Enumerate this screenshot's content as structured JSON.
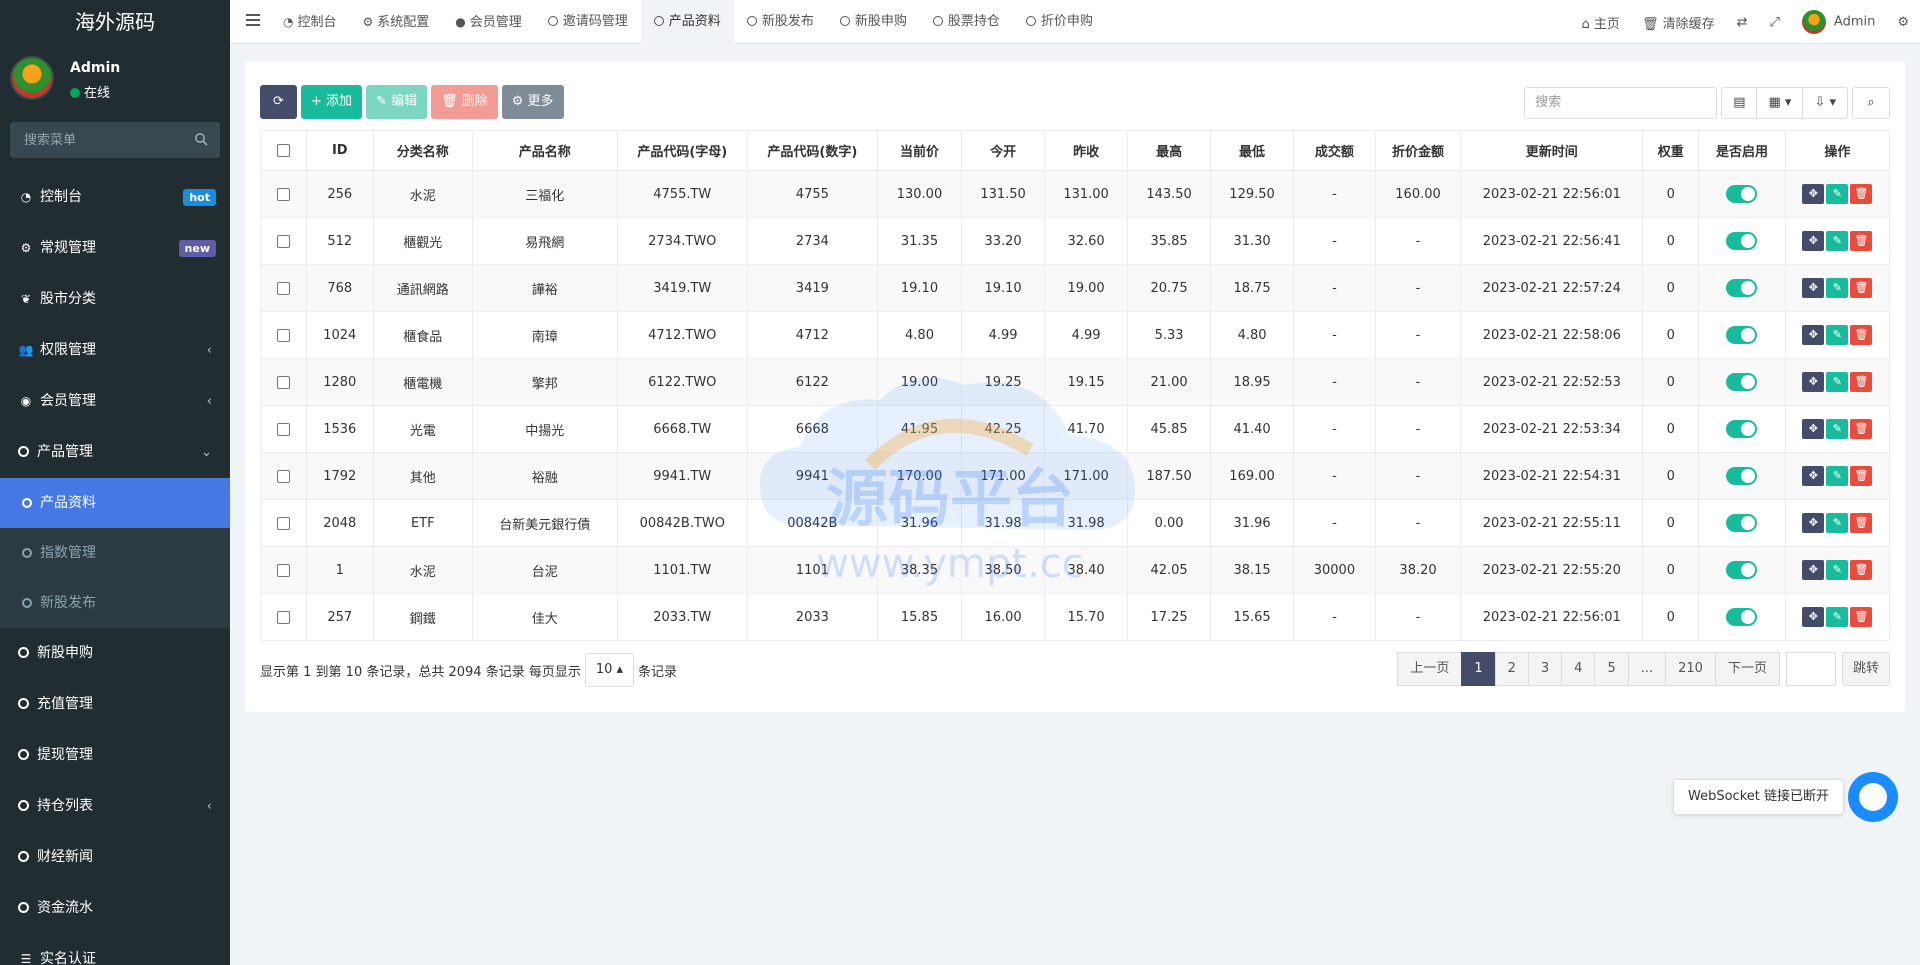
{
  "sidebar": {
    "logo": "海外源码",
    "user": {
      "name": "Admin",
      "status": "在线"
    },
    "search_placeholder": "搜索菜单",
    "items": [
      {
        "label": "控制台",
        "icon": "dashboard-icon",
        "badge": "hot"
      },
      {
        "label": "常规管理",
        "icon": "cogs-icon",
        "badge": "new"
      },
      {
        "label": "股市分类",
        "icon": "leaf-icon"
      },
      {
        "label": "权限管理",
        "icon": "users-icon",
        "chevron": "‹"
      },
      {
        "label": "会员管理",
        "icon": "user-circle-icon",
        "chevron": "‹"
      },
      {
        "label": "产品管理",
        "icon": "circle-icon",
        "chevron": "⌄"
      }
    ],
    "sub_items": [
      {
        "label": "产品资料",
        "active": true
      },
      {
        "label": "指数管理"
      },
      {
        "label": "新股发布"
      }
    ],
    "items_after": [
      {
        "label": "新股申购"
      },
      {
        "label": "充值管理"
      },
      {
        "label": "提现管理"
      },
      {
        "label": "持仓列表",
        "chevron": "‹"
      },
      {
        "label": "财经新闻"
      },
      {
        "label": "资金流水"
      },
      {
        "label": "实名认证"
      }
    ]
  },
  "topnav": {
    "tabs": [
      {
        "label": "控制台",
        "icon": "dashboard-icon"
      },
      {
        "label": "系统配置",
        "icon": "gear-icon"
      },
      {
        "label": "会员管理",
        "icon": "user-icon"
      },
      {
        "label": "邀请码管理",
        "icon": "circle-icon"
      },
      {
        "label": "产品资料",
        "icon": "circle-icon",
        "active": true
      },
      {
        "label": "新股发布",
        "icon": "circle-icon"
      },
      {
        "label": "新股申购",
        "icon": "circle-icon"
      },
      {
        "label": "股票持仓",
        "icon": "circle-icon"
      },
      {
        "label": "折价申购",
        "icon": "circle-icon"
      }
    ],
    "right": {
      "home": "主页",
      "clear_cache": "清除缓存",
      "user": "Admin"
    }
  },
  "toolbar": {
    "refresh_icon": "refresh-icon",
    "add": "添加",
    "edit": "编辑",
    "delete": "删除",
    "more": "更多",
    "search_placeholder": "搜索"
  },
  "table": {
    "columns": [
      "ID",
      "分类名称",
      "产品名称",
      "产品代码(字母)",
      "产品代码(数字)",
      "当前价",
      "今开",
      "昨收",
      "最高",
      "最低",
      "成交额",
      "折价金额",
      "更新时间",
      "权重",
      "是否启用",
      "操作"
    ],
    "rows": [
      [
        "256",
        "水泥",
        "三福化",
        "4755.TW",
        "4755",
        "130.00",
        "131.50",
        "131.00",
        "143.50",
        "129.50",
        "-",
        "160.00",
        "2023-02-21 22:56:01",
        "0"
      ],
      [
        "512",
        "櫃觀光",
        "易飛網",
        "2734.TWO",
        "2734",
        "31.35",
        "33.20",
        "32.60",
        "35.85",
        "31.30",
        "-",
        "-",
        "2023-02-21 22:56:41",
        "0"
      ],
      [
        "768",
        "通訊網路",
        "譁裕",
        "3419.TW",
        "3419",
        "19.10",
        "19.10",
        "19.00",
        "20.75",
        "18.75",
        "-",
        "-",
        "2023-02-21 22:57:24",
        "0"
      ],
      [
        "1024",
        "櫃食品",
        "南璋",
        "4712.TWO",
        "4712",
        "4.80",
        "4.99",
        "4.99",
        "5.33",
        "4.80",
        "-",
        "-",
        "2023-02-21 22:58:06",
        "0"
      ],
      [
        "1280",
        "櫃電機",
        "擎邦",
        "6122.TWO",
        "6122",
        "19.00",
        "19.25",
        "19.15",
        "21.00",
        "18.95",
        "-",
        "-",
        "2023-02-21 22:52:53",
        "0"
      ],
      [
        "1536",
        "光電",
        "中揚光",
        "6668.TW",
        "6668",
        "41.95",
        "42.25",
        "41.70",
        "45.85",
        "41.40",
        "-",
        "-",
        "2023-02-21 22:53:34",
        "0"
      ],
      [
        "1792",
        "其他",
        "裕融",
        "9941.TW",
        "9941",
        "170.00",
        "171.00",
        "171.00",
        "187.50",
        "169.00",
        "-",
        "-",
        "2023-02-21 22:54:31",
        "0"
      ],
      [
        "2048",
        "ETF",
        "台新美元銀行債",
        "00842B.TWO",
        "00842B",
        "31.96",
        "31.98",
        "31.98",
        "0.00",
        "31.96",
        "-",
        "-",
        "2023-02-21 22:55:11",
        "0"
      ],
      [
        "1",
        "水泥",
        "台泥",
        "1101.TW",
        "1101",
        "38.35",
        "38.50",
        "38.40",
        "42.05",
        "38.15",
        "30000",
        "38.20",
        "2023-02-21 22:55:20",
        "0"
      ],
      [
        "257",
        "鋼鐵",
        "佳大",
        "2033.TW",
        "2033",
        "15.85",
        "16.00",
        "15.70",
        "17.25",
        "15.65",
        "-",
        "-",
        "2023-02-21 22:56:01",
        "0"
      ]
    ]
  },
  "footer": {
    "info_prefix": "显示第 1 到第 10 条记录，总共 2094 条记录 每页显示",
    "page_size": "10",
    "info_suffix": "条记录"
  },
  "pagination": {
    "prev": "上一页",
    "pages": [
      "1",
      "2",
      "3",
      "4",
      "5",
      "...",
      "210"
    ],
    "next": "下一页",
    "go": "跳转"
  },
  "watermark": {
    "title": "源码平台",
    "url": "www.ympt.cc"
  },
  "notice": "WebSocket 链接已断开",
  "colors": {
    "sidebar": "#222d32",
    "accent": "#18bc9c",
    "active_menu": "#4679e4",
    "danger": "#e74c3c",
    "dark_btn": "#444c69"
  }
}
